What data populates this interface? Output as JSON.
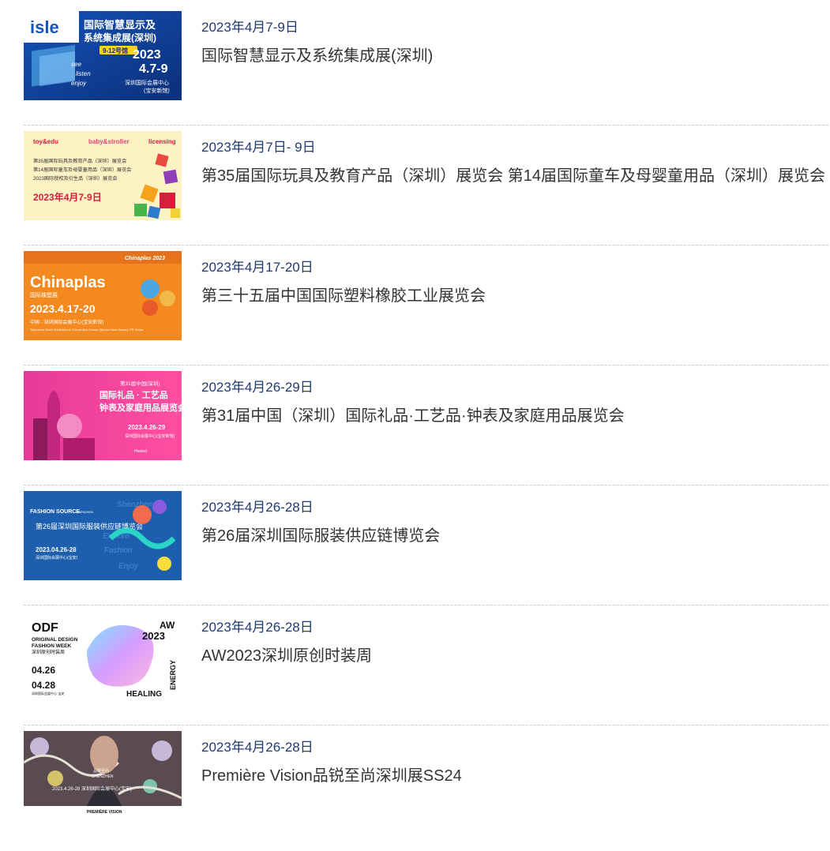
{
  "events": [
    {
      "date": "2023年4月7-9日",
      "title": "国际智慧显示及系统集成展(深圳)",
      "poster": {
        "logo": "isle",
        "headline_1": "国际智慧显示及",
        "headline_2": "系统集成展(深圳)",
        "badge": "9-12号馆",
        "year": "2023",
        "dates": "4.7-9",
        "slogan": [
          "see",
          "listen",
          "enjoy"
        ],
        "venue_1": "深圳国际会展中心",
        "venue_2": "(宝安新馆)"
      }
    },
    {
      "date": "2023年4月7日- 9日",
      "title": "第35届国际玩具及教育产品（深圳）展览会 第14届国际童车及母婴童用品（深圳）展览会",
      "poster": {
        "brands": [
          "toy&edu",
          "baby&stroller",
          "licensing"
        ],
        "line_1": "第35届国际玩具及教育产品（深圳）展览会",
        "line_2": "第14届国际童车及母婴童用品（深圳）展览会",
        "line_3": "2023国际授权及衍生品（深圳）展览会",
        "dates": "2023年4月7-9日"
      }
    },
    {
      "date": "2023年4月17-20日",
      "title": "第三十五届中国国际塑料橡胶工业展览会",
      "poster": {
        "top_label": "Chinaplas 2023",
        "name": "Chinaplas",
        "subname": "国际橡塑展",
        "dates": "2023.4.17-20",
        "venue_cn": "中国 · 深圳国际会展中心(宝安新馆)",
        "venue_en": "Shenzhen World Exhibition & Convention Center (Bao'an New Venue), PR China"
      }
    },
    {
      "date": "2023年4月26-29日",
      "title": "第31届中国（深圳）国际礼品·工艺品·钟表及家庭用品展览会",
      "poster": {
        "edition": "第31届中国(深圳)",
        "line_1": "国际礼品 · 工艺品",
        "line_2": "钟表及家庭用品展览会",
        "dates": "2023.4.26-29",
        "venue": "深圳国际会展中心(宝安新馆)",
        "sponsor": "Hosted"
      }
    },
    {
      "date": "2023年4月26-28日",
      "title": "第26届深圳国际服装供应链博览会",
      "poster": {
        "brand": "FASHION SOURCE",
        "brand_sub": "SHENZHEN",
        "headline": "第26届深圳国际服装供应链博览会",
        "dates": "2023.04.26-28",
        "venue": "深圳国际会展中心(宝安)",
        "script_words": [
          "Shenzhen",
          "Explore",
          "Fashion",
          "Enjoy"
        ]
      }
    },
    {
      "date": "2023年4月26-28日",
      "title": "AW2023深圳原创时装周",
      "poster": {
        "logo": "ODF",
        "brand_1": "ORIGINAL DESIGN",
        "brand_2": "FASHION WEEK",
        "brand_cn": "深圳原创时装周",
        "date_1": "04.26",
        "date_2": "04.28",
        "venue": "深圳国际会展中心·宝安",
        "season": "AW",
        "year": "2023",
        "word_1": "HEALING",
        "word_2": "ENERGY"
      }
    },
    {
      "date": "2023年4月26-28日",
      "title": "Première Vision品锐至尚深圳展SS24",
      "poster": {
        "badge_1": "品锐至尚",
        "badge_2": "SHENZHEN",
        "dates": "2023.4.26-28 深圳国际会展中心(宝安)",
        "brand": "PREMIÈRE VISION"
      }
    }
  ],
  "colors": {
    "date": "#1f3a73",
    "title": "#333333",
    "separator": "#c9c9c9"
  }
}
